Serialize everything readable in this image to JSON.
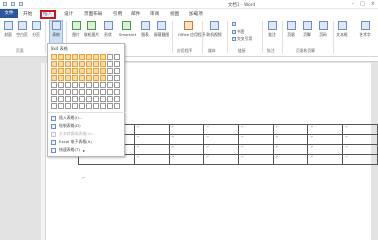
{
  "window": {
    "title": "文档1 - Word"
  },
  "tabs": [
    {
      "label": "文件"
    },
    {
      "label": "开始"
    },
    {
      "label": "插入"
    },
    {
      "label": "设计"
    },
    {
      "label": "页面布局"
    },
    {
      "label": "引用"
    },
    {
      "label": "邮件"
    },
    {
      "label": "审阅"
    },
    {
      "label": "视图"
    },
    {
      "label": "加载项"
    }
  ],
  "ribbon": {
    "buttons": [
      {
        "label": "封面",
        "icon": "cover-icon"
      },
      {
        "label": "空白页",
        "icon": "blank-page-icon"
      },
      {
        "label": "分页",
        "icon": "page-break-icon"
      },
      {
        "label": "表格",
        "icon": "table-icon"
      },
      {
        "label": "图片",
        "icon": "picture-icon"
      },
      {
        "label": "联机图片",
        "icon": "online-picture-icon"
      },
      {
        "label": "形状",
        "icon": "shapes-icon"
      },
      {
        "label": "SmartArt",
        "icon": "smartart-icon"
      },
      {
        "label": "图表",
        "icon": "chart-icon"
      },
      {
        "label": "屏幕截图",
        "icon": "screenshot-icon"
      },
      {
        "label": "Office 应用程序",
        "icon": "office-apps-icon"
      },
      {
        "label": "联机视频",
        "icon": "online-video-icon"
      },
      {
        "label": "批注",
        "icon": "comment-icon"
      },
      {
        "label": "页眉",
        "icon": "header-icon"
      },
      {
        "label": "页脚",
        "icon": "footer-icon"
      },
      {
        "label": "页码",
        "icon": "page-number-icon"
      },
      {
        "label": "文本框",
        "icon": "textbox-icon"
      },
      {
        "label": "艺术字",
        "icon": "wordart-icon"
      }
    ],
    "small_items": [
      {
        "label": "书签"
      },
      {
        "label": "交叉引用"
      }
    ],
    "groups": [
      {
        "label": "页面"
      },
      {
        "label": "表格"
      },
      {
        "label": "应用程序"
      },
      {
        "label": "媒体"
      },
      {
        "label": "链接"
      },
      {
        "label": "批注"
      },
      {
        "label": "页眉和页脚"
      }
    ]
  },
  "table_dropdown": {
    "header": "8x4 表格",
    "columns": 10,
    "rows": 8,
    "selected_cols": 8,
    "selected_rows": 4,
    "items": [
      {
        "label": "插入表格(I)...",
        "enabled": true
      },
      {
        "label": "绘制表格(D)",
        "enabled": true
      },
      {
        "label": "文本转换成表格(V)...",
        "enabled": false
      },
      {
        "label": "Excel 电子表格(X)",
        "enabled": true
      },
      {
        "label": "快速表格(T)",
        "enabled": true
      }
    ]
  },
  "document": {
    "table_rows": 4,
    "table_cols": 8,
    "cell_mark": "↵",
    "after_mark": "↵"
  }
}
